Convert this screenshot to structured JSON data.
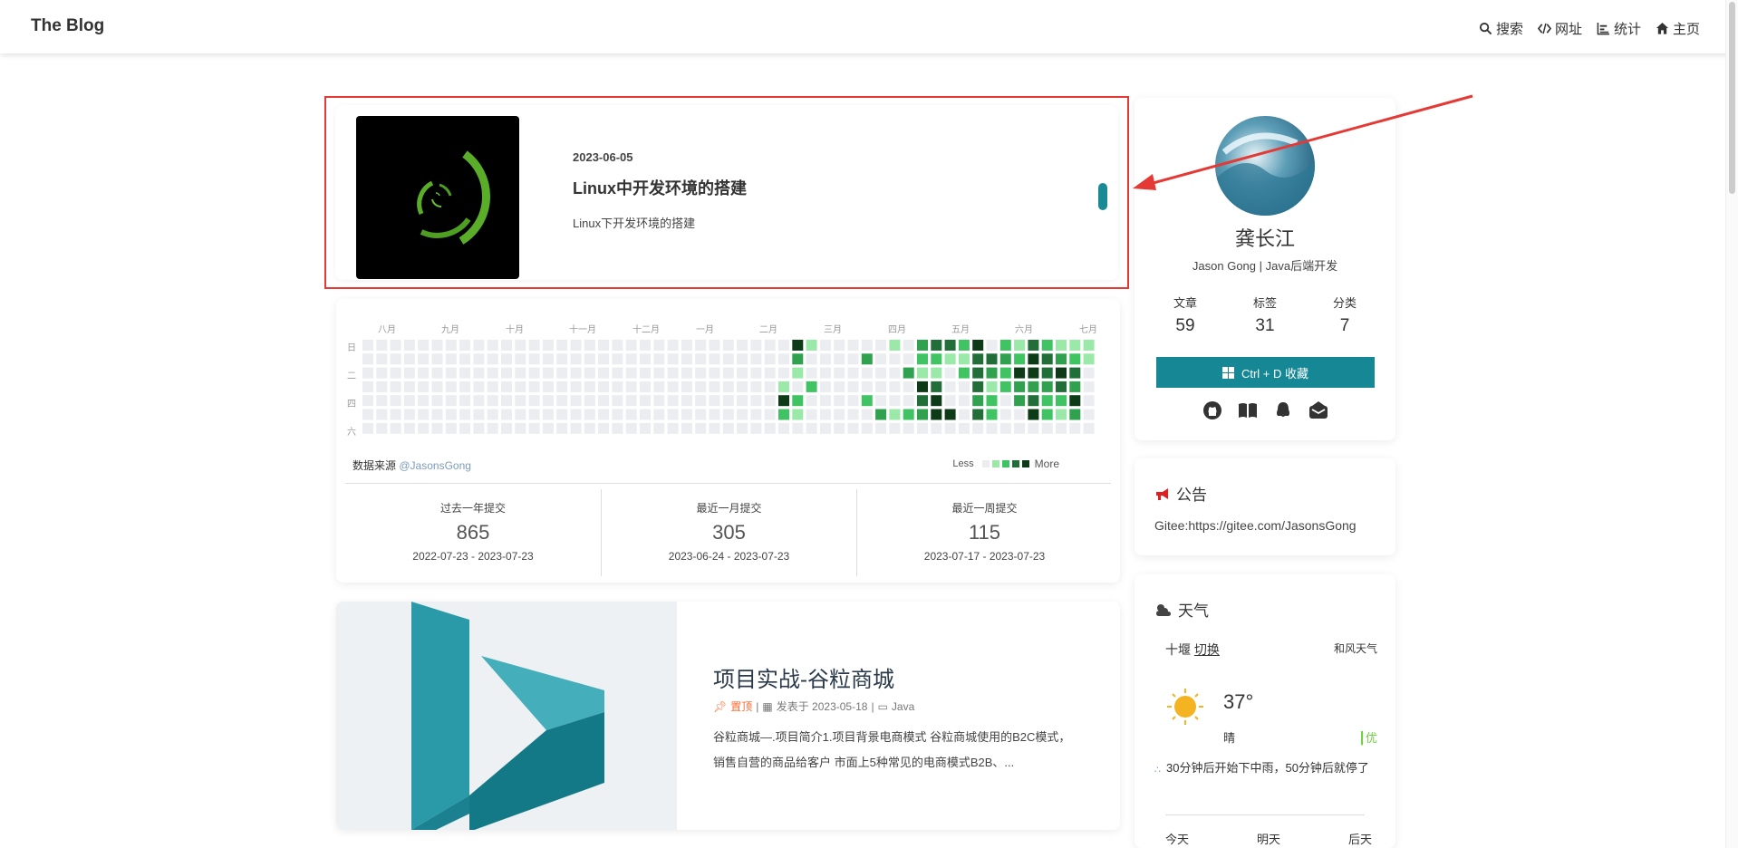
{
  "header": {
    "brand": "The Blog",
    "nav": [
      {
        "label": "搜索",
        "icon": "search-icon"
      },
      {
        "label": "网址",
        "icon": "code-icon"
      },
      {
        "label": "统计",
        "icon": "bar-chart-icon"
      },
      {
        "label": "主页",
        "icon": "home-icon"
      }
    ]
  },
  "featured": {
    "date": "2023-06-05",
    "title": "Linux中开发环境的搭建",
    "desc": "Linux下开发环境的搭建"
  },
  "contrib": {
    "months": [
      "八月",
      "九月",
      "十月",
      "十一月",
      "十二月",
      "一月",
      "二月",
      "三月",
      "四月",
      "五月",
      "六月",
      "七月"
    ],
    "weekdays": [
      "日",
      "二",
      "四",
      "六"
    ],
    "source_label": "数据来源",
    "source_user": "@JasonsGong",
    "legend_less": "Less",
    "legend_more": "More",
    "colors": [
      "#ebedf0",
      "#9be9a8",
      "#40c463",
      "#30a14e",
      "#216e39",
      "#0e3b17"
    ],
    "stats": [
      {
        "label": "过去一年提交",
        "value": "865",
        "range": "2022-07-23 - 2023-07-23"
      },
      {
        "label": "最近一月提交",
        "value": "305",
        "range": "2023-06-24 - 2023-07-23"
      },
      {
        "label": "最近一周提交",
        "value": "115",
        "range": "2023-07-17 - 2023-07-23"
      }
    ]
  },
  "post": {
    "title": "项目实战-谷粒商城",
    "pinned": "置顶",
    "published": "发表于 2023-05-18",
    "category": "Java",
    "excerpt": "谷粒商城—.项目简介1.项目背景电商模式 谷粒商城使用的B2C模式，销售自营的商品给客户 市面上5种常见的电商模式B2B、..."
  },
  "profile": {
    "name": "龚长江",
    "subtitle": "Jason Gong | Java后端开发",
    "stats": [
      {
        "label": "文章",
        "value": "59"
      },
      {
        "label": "标签",
        "value": "31"
      },
      {
        "label": "分类",
        "value": "7"
      }
    ],
    "bookmark": "Ctrl + D 收藏",
    "socials": [
      "github-icon",
      "book-icon",
      "qq-icon",
      "mail-icon"
    ]
  },
  "notice": {
    "title": "公告",
    "text": "Gitee:https://gitee.com/JasonsGong"
  },
  "weather": {
    "title": "天气",
    "city": "十堰",
    "switch": "切换",
    "source": "和风天气",
    "temp": "37°",
    "condition": "晴",
    "aqi": "优",
    "rain": "30分钟后开始下中雨，50分钟后就停了",
    "days": [
      "今天",
      "明天",
      "后天"
    ]
  }
}
